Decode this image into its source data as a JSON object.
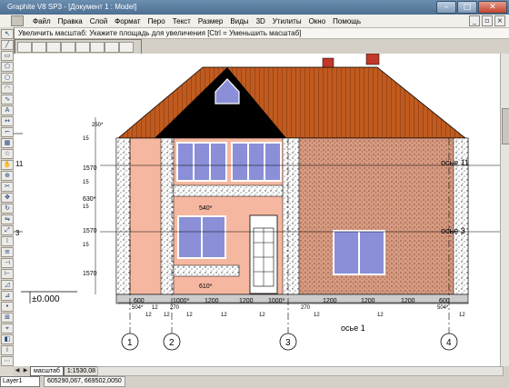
{
  "window": {
    "title": "Graphite V8 SP3 - [Документ 1 : Model]"
  },
  "menu": [
    "Файл",
    "Правка",
    "Слой",
    "Формат",
    "Перо",
    "Текст",
    "Размер",
    "Виды",
    "3D",
    "Утилиты",
    "Окно",
    "Помощь"
  ],
  "prompt": "Увеличить масштаб: Укажите площадь для увеличения  [Ctrl = Уменьшить масштаб]",
  "drawing": {
    "dims_top": [
      "250*",
      "15",
      "1570",
      "15",
      "630*",
      "15",
      "1570",
      "15",
      "1570"
    ],
    "dims_mid": [
      "540*",
      "610*"
    ],
    "dims_bottom_row1": [
      "600",
      "504*",
      "12",
      "1000*",
      "1200",
      "1200",
      "1000*",
      "270",
      "1200",
      "1200",
      "1200",
      "600",
      "504*"
    ],
    "dims_bottom_row2": [
      "270"
    ],
    "zeros": [
      "12",
      "12",
      "12",
      "12",
      "12",
      "12",
      "12",
      "12"
    ],
    "axes_bubbles": [
      "1",
      "2",
      "3",
      "4"
    ],
    "axis_labels": [
      "осье 11",
      "осье 3",
      "осье 1",
      "осье 3",
      "осье 11"
    ],
    "level": "±0.000",
    "left_labels": [
      "11",
      "3"
    ]
  },
  "bottom": {
    "tabs": [
      "масштаб",
      "1:1530.08"
    ],
    "layer": "Layer1",
    "coords": "605290,067, 669502,0050"
  },
  "colors": {
    "roof": "#b5531b",
    "plaster_pink": "#f5b7a0",
    "brick": "#c8866a",
    "sky": "#ffffff",
    "glass": "#8a8fd8"
  }
}
